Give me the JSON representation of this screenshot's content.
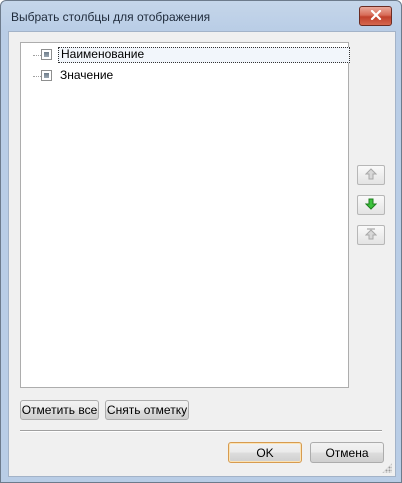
{
  "dialog": {
    "title": "Выбрать столбцы для отображения",
    "close_icon": "close-x-icon"
  },
  "columns": {
    "items": [
      {
        "label": "Наименование",
        "checked": "indeterminate",
        "selected": true
      },
      {
        "label": "Значение",
        "checked": "indeterminate",
        "selected": false
      }
    ]
  },
  "side_buttons": {
    "move_up_icon": "arrow-up-icon",
    "move_down_icon": "arrow-down-icon",
    "move_top_icon": "arrow-top-icon",
    "down_color": "#2fa42f",
    "disabled_color": "#a8a8a8"
  },
  "actions": {
    "check_all": "Отметить все",
    "uncheck_all": "Снять отметку",
    "ok": "OK",
    "cancel": "Отмена"
  },
  "colors": {
    "close_button": "#c1402b",
    "default_button_border": "#d79b4f"
  }
}
